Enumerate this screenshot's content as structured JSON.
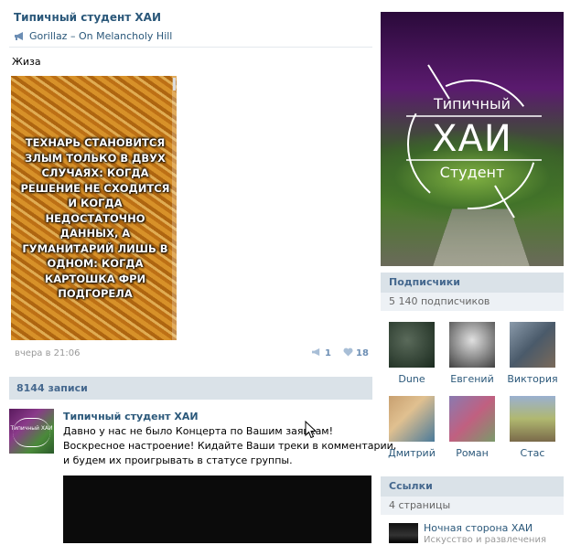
{
  "group": {
    "name": "Типичный студент ХАИ"
  },
  "status": {
    "song": "Gorillaz – On Melancholy Hill"
  },
  "post": {
    "text": "Жиза",
    "meme_text": "ТЕХНАРЬ СТАНОВИТСЯ ЗЛЫМ ТОЛЬКО В ДВУХ СЛУЧАЯХ: КОГДА РЕШЕНИЕ НЕ СХОДИТСЯ И КОГДА НЕДОСТАТОЧНО ДАННЫХ, А ГУМАНИТАРИЙ ЛИШЬ В ОДНОМ: КОГДА КАРТОШКА ФРИ ПОДГОРЕЛА",
    "time": "вчера в 21:06",
    "reposts": "1",
    "likes": "18"
  },
  "wall": {
    "count_label": "8144 записи",
    "post": {
      "author": "Типичный студент ХАИ",
      "text_lines": [
        "Давно у нас не было Концерта по Вашим заявкам!",
        "Воскресное настроение! Кидайте Ваши треки в комментарии,",
        "и будем их проигрывать в статусе группы."
      ],
      "avatar_text": "Типичный ХАИ"
    }
  },
  "cover": {
    "line1": "Типичный",
    "line2": "ХАИ",
    "line3": "Студент"
  },
  "subscribers": {
    "title": "Подписчики",
    "count": "5 140 подписчиков",
    "people": [
      {
        "name": "Dune",
        "color": "#2a3a2e"
      },
      {
        "name": "Евгений",
        "color": "#8a8a8a"
      },
      {
        "name": "Виктория",
        "color": "#5a6a7a"
      },
      {
        "name": "Дмитрий",
        "color": "#c8a070"
      },
      {
        "name": "Роман",
        "color": "#8a7ab0"
      },
      {
        "name": "Стас",
        "color": "#b0b870"
      }
    ]
  },
  "links": {
    "title": "Ссылки",
    "count": "4 страницы",
    "items": [
      {
        "name": "Ночная сторона ХАИ",
        "desc": "Искусство и развлечения"
      }
    ]
  },
  "colors": {
    "accent": "#2B587A",
    "header_bg": "#DAE2E8"
  }
}
